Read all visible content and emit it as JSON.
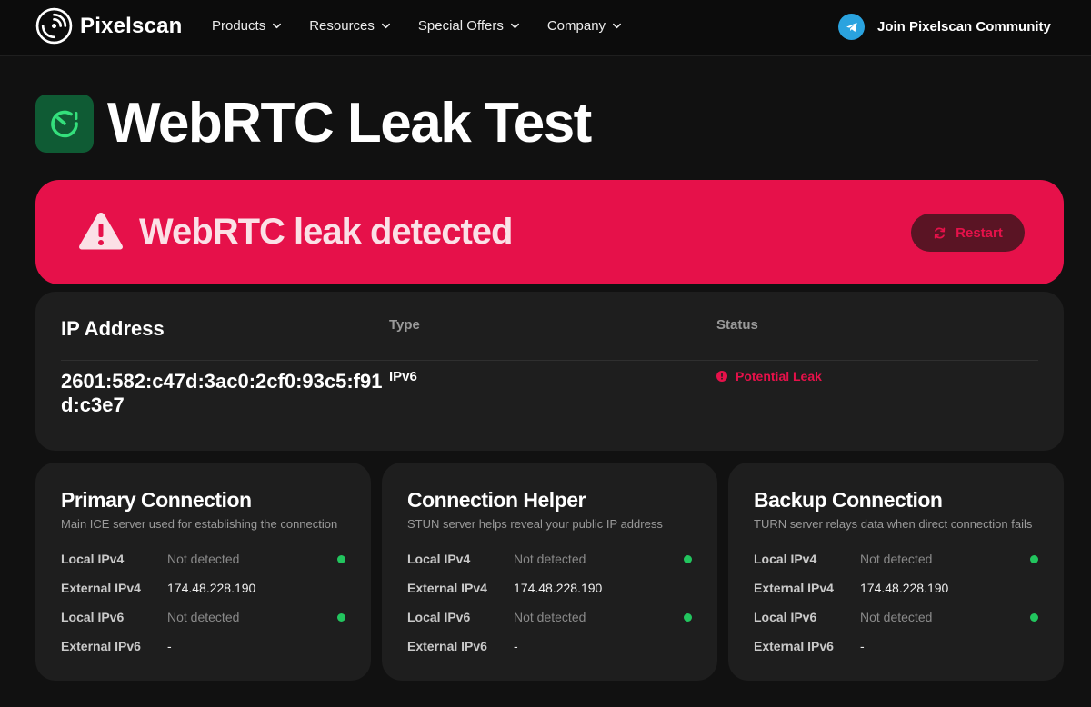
{
  "nav": {
    "brand": "Pixelscan",
    "menu": [
      {
        "label": "Products"
      },
      {
        "label": "Resources"
      },
      {
        "label": "Special Offers"
      },
      {
        "label": "Company"
      }
    ],
    "community_label": "Join Pixelscan Community",
    "community_icon": "telegram-icon"
  },
  "page": {
    "title": "WebRTC Leak Test",
    "title_icon": "webrtc-alert-icon"
  },
  "banner": {
    "message": "WebRTC leak detected",
    "restart_label": "Restart",
    "color": "#e6114a"
  },
  "ip_table": {
    "headers": {
      "ip": "IP Address",
      "type": "Type",
      "status": "Status"
    },
    "rows": [
      {
        "ip": "2601:582:c47d:3ac0:2cf0:93c5:f91d:c3e7",
        "type": "IPv6",
        "status": "Potential Leak"
      }
    ]
  },
  "connections": [
    {
      "title": "Primary Connection",
      "subtitle": "Main ICE server used for establishing the connection",
      "rows": [
        {
          "label": "Local IPv4",
          "value": "Not detected",
          "muted": true,
          "dot": true
        },
        {
          "label": "External IPv4",
          "value": "174.48.228.190",
          "muted": false,
          "dot": false
        },
        {
          "label": "Local IPv6",
          "value": "Not detected",
          "muted": true,
          "dot": true
        },
        {
          "label": "External IPv6",
          "value": "-",
          "muted": false,
          "dot": false
        }
      ]
    },
    {
      "title": "Connection Helper",
      "subtitle": "STUN server helps reveal your public IP address",
      "rows": [
        {
          "label": "Local IPv4",
          "value": "Not detected",
          "muted": true,
          "dot": true
        },
        {
          "label": "External IPv4",
          "value": "174.48.228.190",
          "muted": false,
          "dot": false
        },
        {
          "label": "Local IPv6",
          "value": "Not detected",
          "muted": true,
          "dot": true
        },
        {
          "label": "External IPv6",
          "value": "-",
          "muted": false,
          "dot": false
        }
      ]
    },
    {
      "title": "Backup Connection",
      "subtitle": "TURN server relays data when direct connection fails",
      "rows": [
        {
          "label": "Local IPv4",
          "value": "Not detected",
          "muted": true,
          "dot": true
        },
        {
          "label": "External IPv4",
          "value": "174.48.228.190",
          "muted": false,
          "dot": false
        },
        {
          "label": "Local IPv6",
          "value": "Not detected",
          "muted": true,
          "dot": true
        },
        {
          "label": "External IPv6",
          "value": "-",
          "muted": false,
          "dot": false
        }
      ]
    }
  ],
  "colors": {
    "background": "#111111",
    "card": "#1e1e1e",
    "accent_red": "#e6114a",
    "status_green": "#22c55e",
    "brand_green": "#0f5b34"
  }
}
